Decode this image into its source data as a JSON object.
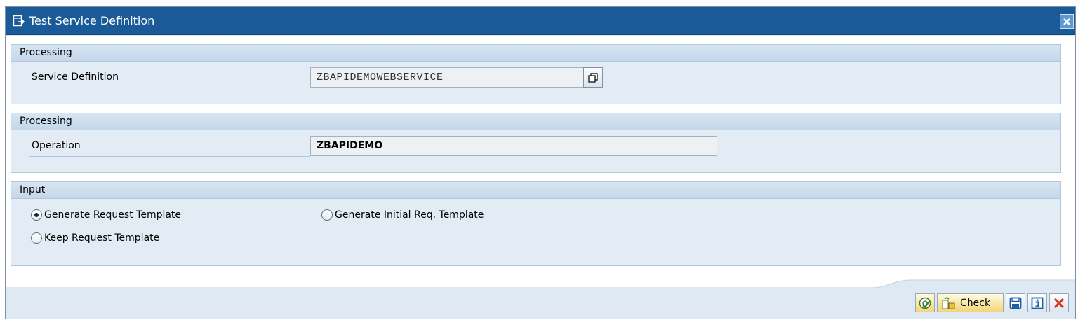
{
  "window": {
    "title": "Test Service Definition"
  },
  "groups": [
    {
      "header": "Processing",
      "fields": [
        {
          "label": "Service Definition",
          "value": "ZBAPIDEMOWEBSERVICE"
        }
      ]
    },
    {
      "header": "Processing",
      "fields": [
        {
          "label": "Operation",
          "value": "ZBAPIDEMO"
        }
      ]
    },
    {
      "header": "Input",
      "options": [
        {
          "label": "Generate Request Template",
          "selected": true
        },
        {
          "label": "Generate Initial Req. Template",
          "selected": false
        },
        {
          "label": "Keep Request Template",
          "selected": false
        }
      ]
    }
  ],
  "toolbar": {
    "check_label": "Check",
    "buttons": [
      "execute-icon",
      "check-icon",
      "save-icon",
      "info-icon",
      "cancel-icon"
    ]
  },
  "colors": {
    "titlebar": "#1b5a99",
    "panel": "#e3ecf5",
    "field": "#edf1f4",
    "cancel": "#d8351b"
  }
}
